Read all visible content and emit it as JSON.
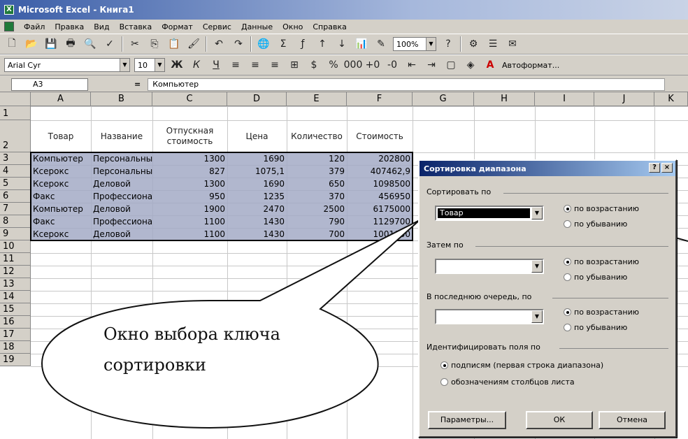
{
  "window": {
    "title": "Microsoft Excel - Книга1"
  },
  "menu": [
    "Файл",
    "Правка",
    "Вид",
    "Вставка",
    "Формат",
    "Сервис",
    "Данные",
    "Окно",
    "Справка"
  ],
  "toolbar": {
    "zoom": "100%",
    "autoformat": "Автоформат..."
  },
  "format": {
    "font": "Arial Cyr",
    "size": "10"
  },
  "formula": {
    "namebox": "A3",
    "eq": "=",
    "value": "Компьютер"
  },
  "columns": [
    "A",
    "B",
    "C",
    "D",
    "E",
    "F",
    "G",
    "H",
    "I",
    "J",
    "K"
  ],
  "rows": [
    "1",
    "2",
    "3",
    "4",
    "5",
    "6",
    "7",
    "8",
    "9",
    "10",
    "11",
    "12",
    "13",
    "14",
    "15",
    "16",
    "17",
    "18",
    "19"
  ],
  "headers": [
    "Товар",
    "Название",
    "Отпускная стоимость",
    "Цена",
    "Количество",
    "Стоимость"
  ],
  "data": [
    [
      "Компьютер",
      "Персональный",
      "1300",
      "1690",
      "120",
      "202800"
    ],
    [
      "Ксерокс",
      "Персональный",
      "827",
      "1075,1",
      "379",
      "407462,9"
    ],
    [
      "Ксерокс",
      "Деловой",
      "1300",
      "1690",
      "650",
      "1098500"
    ],
    [
      "Факс",
      "Профессиональный",
      "950",
      "1235",
      "370",
      "456950"
    ],
    [
      "Компьютер",
      "Деловой",
      "1900",
      "2470",
      "2500",
      "6175000"
    ],
    [
      "Факс",
      "Профессиональный",
      "1100",
      "1430",
      "790",
      "1129700"
    ],
    [
      "Ксерокс",
      "Деловой",
      "1100",
      "1430",
      "700",
      "1001000"
    ]
  ],
  "dialog": {
    "title": "Сортировка диапазона",
    "help": "?",
    "close": "×",
    "sortby": "Сортировать по",
    "sortby_value": "Товар",
    "then": "Затем по",
    "last": "В последнюю очередь, по",
    "asc": "по возрастанию",
    "desc": "по убыванию",
    "identify": "Идентифицировать поля по",
    "by_labels": "подписям (первая строка диапазона)",
    "by_letters": "обозначениям столбцов листа",
    "params": "Параметры...",
    "ok": "ОК",
    "cancel": "Отмена"
  },
  "callout": {
    "line1": "Окно выбора ключа",
    "line2": "сортировки"
  }
}
